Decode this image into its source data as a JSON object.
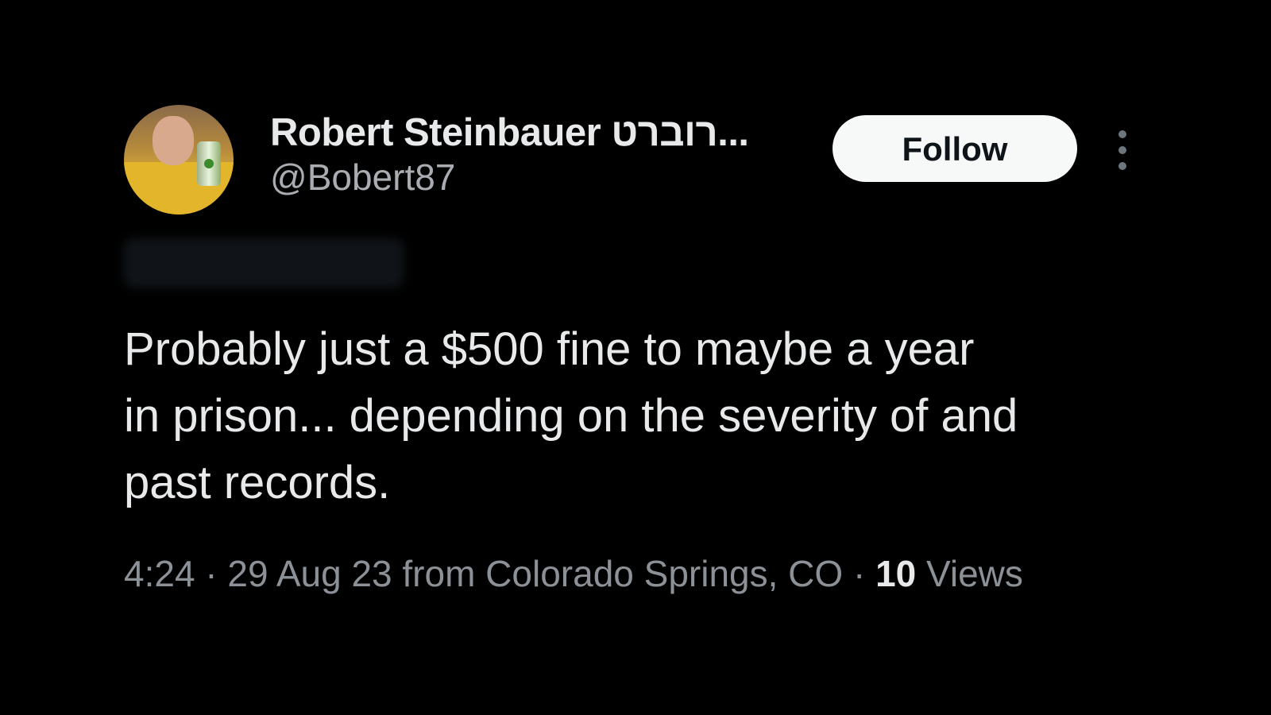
{
  "author": {
    "display_name": "Robert Steinbauer רוברט...",
    "handle": "@Bobert87"
  },
  "follow_button": {
    "label": "Follow"
  },
  "more_icon": "more-vertical-icon",
  "tweet": {
    "text_line1": "Probably just a $500 fine to maybe a year",
    "text_line2": "in prison... depending on the severity of and",
    "text_line3": "past records."
  },
  "meta": {
    "time": "4:24",
    "separator": " · ",
    "date_location": "29 Aug 23 from Colorado Springs, CO",
    "views_count": "10",
    "views_label": " Views"
  },
  "colors": {
    "background": "#000000",
    "text_primary": "#e7e9ea",
    "text_secondary": "#8b9196",
    "button_bg": "#f7f9f9",
    "button_text": "#0f1419"
  }
}
